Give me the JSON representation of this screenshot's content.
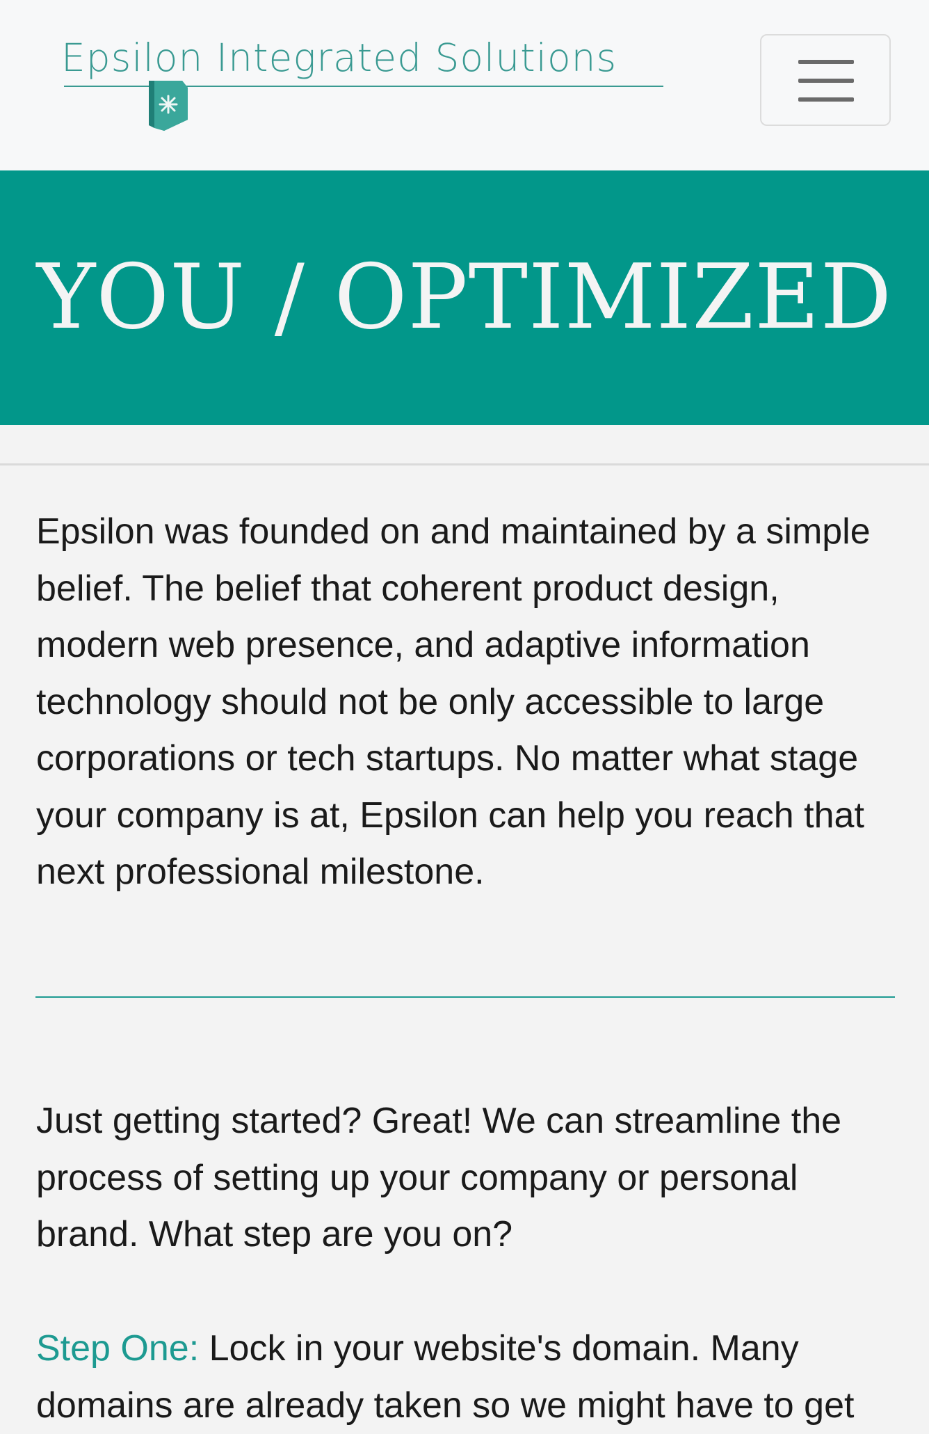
{
  "header": {
    "brand_name": "Epsilon Integrated Solutions",
    "logo_icon": "shield-star-icon",
    "menu_icon": "hamburger-menu-icon",
    "colors": {
      "brand": "#3a9a92",
      "hero_background": "#02978a",
      "accent_text": "#1d9a91"
    }
  },
  "hero": {
    "title": "YOU / OPTIMIZED"
  },
  "main": {
    "intro": "Epsilon was founded on and maintained by a simple belief. The belief that coherent product design, modern web presence, and adaptive information technology should not be only accessible to large corporations or tech startups. No matter what stage your company is at, Epsilon can help you reach that next professional milestone.",
    "getting_started": "Just getting started? Great! We can streamline the process of setting up your company or personal brand. What step are you on?",
    "step_one_label": "Step One:",
    "step_one_text": " Lock in your website's domain. Many domains are already taken so we might have to get"
  }
}
